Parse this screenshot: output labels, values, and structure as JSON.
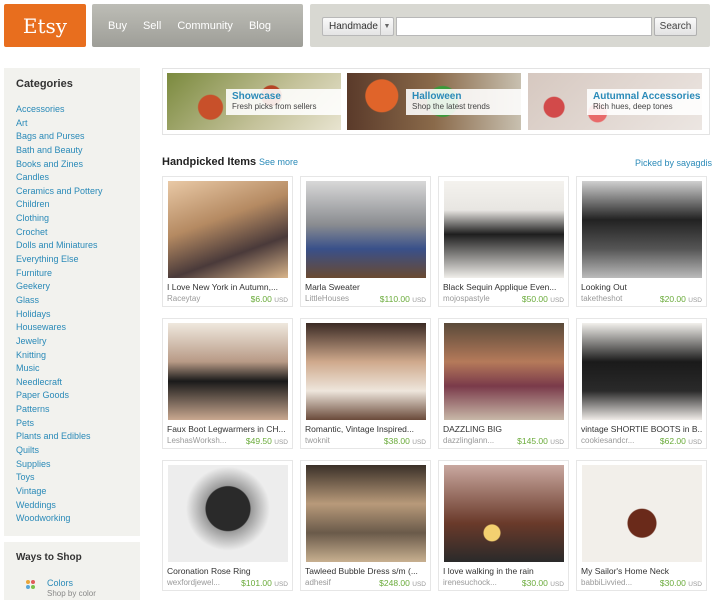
{
  "header": {
    "logo": "Etsy",
    "nav": [
      "Buy",
      "Sell",
      "Community",
      "Blog"
    ],
    "search": {
      "category": "Handmade",
      "placeholder": "",
      "button": "Search"
    }
  },
  "sidebar": {
    "title": "Categories",
    "items": [
      "Accessories",
      "Art",
      "Bags and Purses",
      "Bath and Beauty",
      "Books and Zines",
      "Candles",
      "Ceramics and Pottery",
      "Children",
      "Clothing",
      "Crochet",
      "Dolls and Miniatures",
      "Everything Else",
      "Furniture",
      "Geekery",
      "Glass",
      "Holidays",
      "Housewares",
      "Jewelry",
      "Knitting",
      "Music",
      "Needlecraft",
      "Paper Goods",
      "Patterns",
      "Pets",
      "Plants and Edibles",
      "Quilts",
      "Supplies",
      "Toys",
      "Vintage",
      "Weddings",
      "Woodworking"
    ]
  },
  "ways": {
    "title": "Ways to Shop",
    "label": "Colors",
    "sub": "Shop by color"
  },
  "banners": [
    {
      "title": "Showcase",
      "subtitle": "Fresh picks from sellers"
    },
    {
      "title": "Halloween",
      "subtitle": "Shop the latest trends"
    },
    {
      "title": "Autumnal Accessories",
      "subtitle": "Rich hues, deep tones"
    }
  ],
  "handpicked": {
    "title": "Handpicked Items",
    "more": "See more",
    "by": "Picked by sayagdis"
  },
  "items": [
    {
      "title": "I Love New York in Autumn,...",
      "seller": "Raceytay",
      "price": "$6.00",
      "cur": "USD"
    },
    {
      "title": "Marla Sweater",
      "seller": "LittleHouses",
      "price": "$110.00",
      "cur": "USD"
    },
    {
      "title": "Black Sequin Applique Even...",
      "seller": "mojospastyle",
      "price": "$50.00",
      "cur": "USD"
    },
    {
      "title": "Looking Out",
      "seller": "taketheshot",
      "price": "$20.00",
      "cur": "USD"
    },
    {
      "title": "Faux Boot Legwarmers in CH...",
      "seller": "LeshasWorksh...",
      "price": "$49.50",
      "cur": "USD"
    },
    {
      "title": "Romantic, Vintage Inspired...",
      "seller": "twoknit",
      "price": "$38.00",
      "cur": "USD"
    },
    {
      "title": "DAZZLING BIG",
      "seller": "dazzlinglann...",
      "price": "$145.00",
      "cur": "USD"
    },
    {
      "title": "vintage SHORTIE BOOTS in B...",
      "seller": "cookiesandcr...",
      "price": "$62.00",
      "cur": "USD"
    },
    {
      "title": "Coronation Rose Ring",
      "seller": "wexfordjewel...",
      "price": "$101.00",
      "cur": "USD"
    },
    {
      "title": "Tawleed Bubble Dress s/m (...",
      "seller": "adhesif",
      "price": "$248.00",
      "cur": "USD"
    },
    {
      "title": "I love walking in the rain",
      "seller": "irenesuchock...",
      "price": "$30.00",
      "cur": "USD"
    },
    {
      "title": "My Sailor's Home Neck",
      "seller": "babbiLivvied...",
      "price": "$30.00",
      "cur": "USD"
    }
  ]
}
